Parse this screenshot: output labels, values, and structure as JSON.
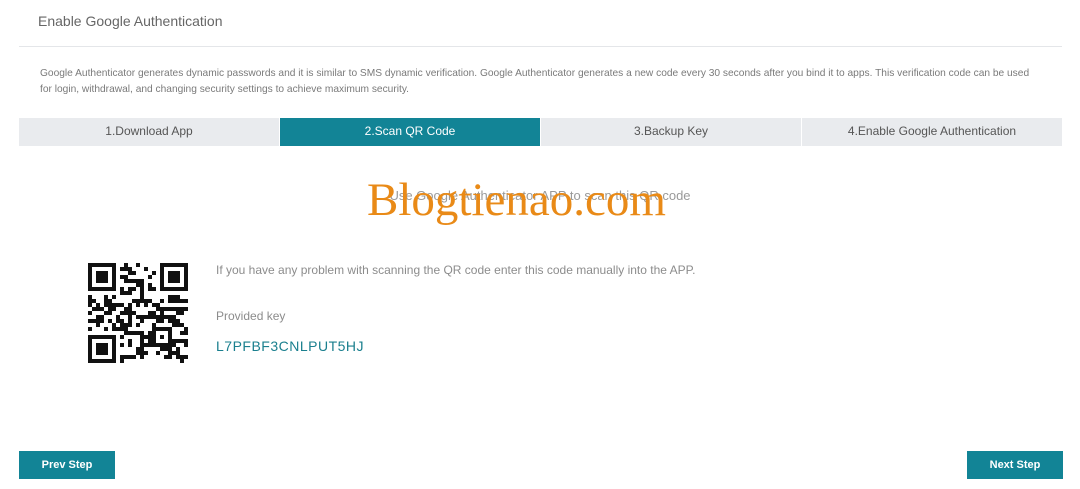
{
  "header": {
    "title": "Enable Google Authentication"
  },
  "description": "Google Authenticator generates dynamic passwords and it is similar to SMS dynamic verification. Google Authenticator generates a new code every 30 seconds after you bind it to apps. This verification code can be used for login, withdrawal, and changing security settings to achieve maximum security.",
  "steps": [
    {
      "label": "1.Download App",
      "active": false
    },
    {
      "label": "2.Scan QR Code",
      "active": true
    },
    {
      "label": "3.Backup Key",
      "active": false
    },
    {
      "label": "4.Enable Google Authentication",
      "active": false
    }
  ],
  "scan": {
    "instruction": "Use Google Authenticator APP to scan this QR code",
    "manual_hint": "If you have any problem with scanning the QR code enter this code manually into the APP.",
    "key_label": "Provided key",
    "key_value": "L7PFBF3CNLPUT5HJ"
  },
  "watermark": "Blogtienao.com",
  "buttons": {
    "prev": "Prev Step",
    "next": "Next Step"
  },
  "colors": {
    "accent": "#128496",
    "key_text": "#1a7f8e",
    "watermark": "#e98a17"
  }
}
